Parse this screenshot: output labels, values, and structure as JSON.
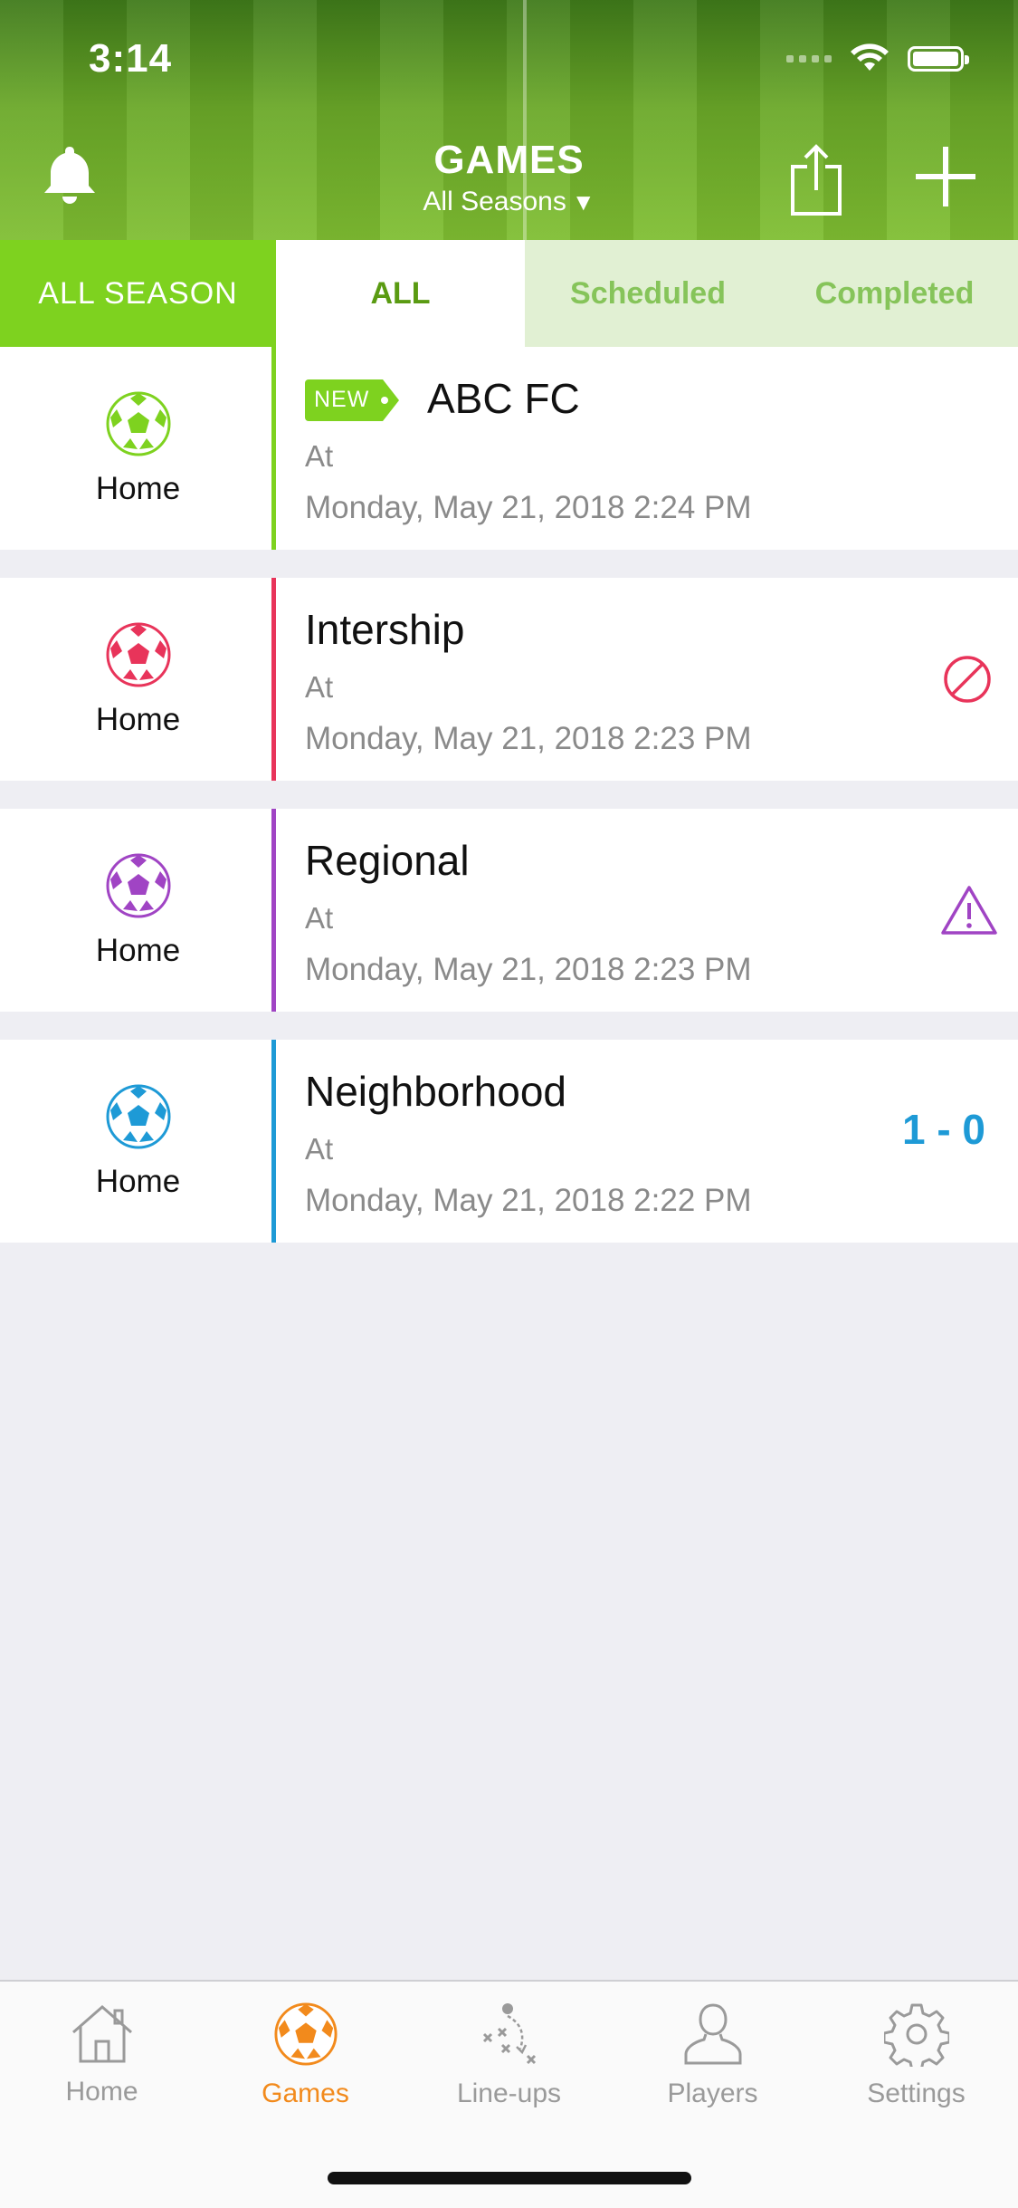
{
  "status_bar": {
    "time": "3:14"
  },
  "header": {
    "title": "GAMES",
    "subtitle": "All Seasons",
    "subtitle_caret": "▼"
  },
  "tabs": [
    {
      "label": "ALL SEASON"
    },
    {
      "label": "ALL"
    },
    {
      "label": "Scheduled"
    },
    {
      "label": "Completed"
    }
  ],
  "games": [
    {
      "name": "ABC FC",
      "badge": "NEW",
      "location": "Home",
      "at": "At",
      "datetime": "Monday, May 21, 2018 2:24 PM",
      "color": "#7ed21f",
      "status": "none"
    },
    {
      "name": "Intership",
      "location": "Home",
      "at": "At",
      "datetime": "Monday, May 21, 2018 2:23 PM",
      "color": "#e8345a",
      "status": "cancelled-icon"
    },
    {
      "name": "Regional",
      "location": "Home",
      "at": "At",
      "datetime": "Monday, May 21, 2018 2:23 PM",
      "color": "#a044c4",
      "status": "warning-icon"
    },
    {
      "name": "Neighborhood",
      "location": "Home",
      "at": "At",
      "datetime": "Monday, May 21, 2018 2:22 PM",
      "color": "#1e9ad6",
      "status": "score",
      "score": "1 - 0"
    }
  ],
  "tabbar": {
    "items": [
      {
        "label": "Home",
        "icon": "house-icon"
      },
      {
        "label": "Games",
        "icon": "soccer-ball-icon"
      },
      {
        "label": "Line-ups",
        "icon": "tactics-icon"
      },
      {
        "label": "Players",
        "icon": "person-icon"
      },
      {
        "label": "Settings",
        "icon": "gear-icon"
      }
    ],
    "active_color": "#f28a1c",
    "inactive_color": "#9a9a9a"
  }
}
